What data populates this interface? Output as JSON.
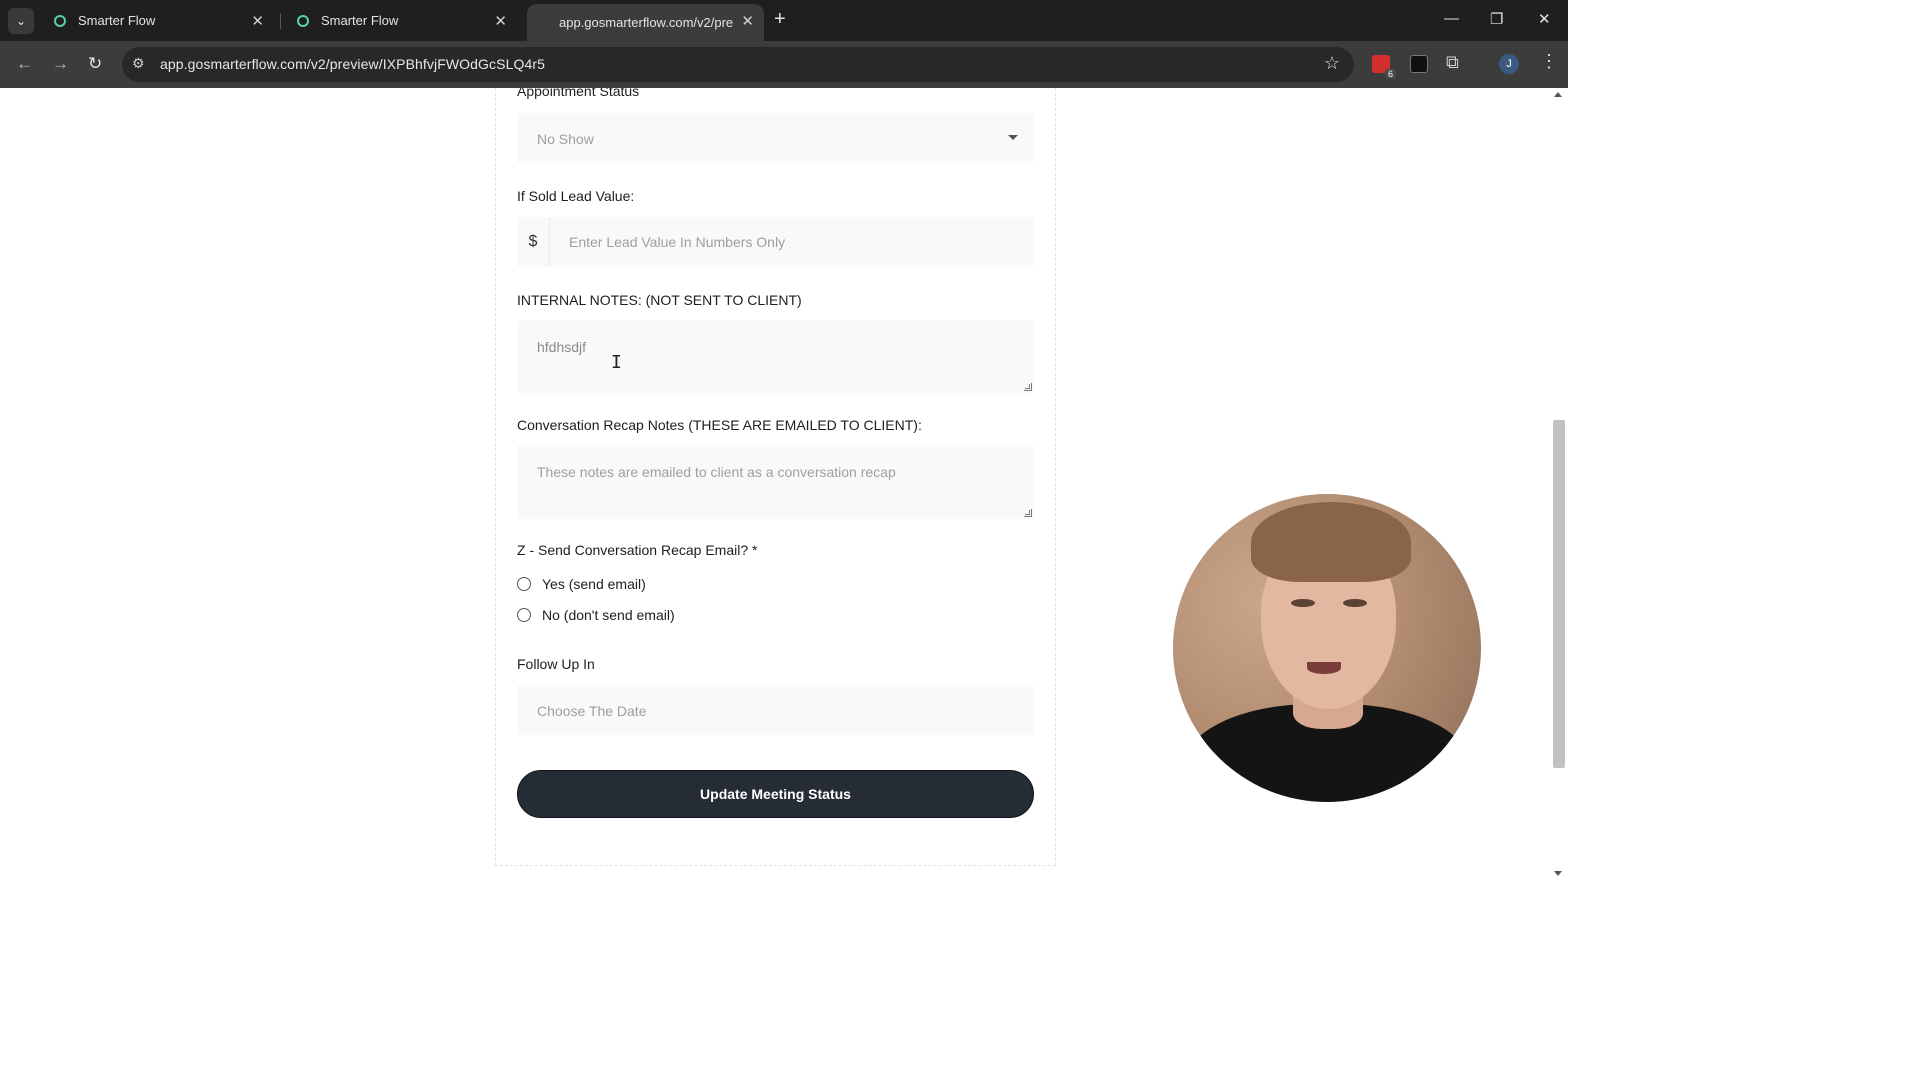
{
  "browser": {
    "tabs": [
      {
        "title": "Smarter Flow"
      },
      {
        "title": "Smarter Flow"
      },
      {
        "title": "app.gosmarterflow.com/v2/pre"
      }
    ],
    "url": "app.gosmarterflow.com/v2/preview/IXPBhfvjFWOdGcSLQ4r5",
    "extension_badge": "6",
    "profile_initial": "J"
  },
  "form": {
    "appointment_status": {
      "label": "Appointment Status",
      "selected": "No Show"
    },
    "lead_value": {
      "label": "If Sold Lead Value:",
      "prefix": "$",
      "placeholder": "Enter Lead Value In Numbers Only"
    },
    "internal_notes": {
      "label": "INTERNAL NOTES: (NOT SENT TO CLIENT)",
      "value": "hfdhsdjf"
    },
    "recap_notes": {
      "label": "Conversation Recap Notes (THESE ARE EMAILED TO CLIENT):",
      "placeholder": "These notes are emailed to client as a conversation recap"
    },
    "send_email": {
      "label": "Z - Send Conversation Recap Email? *",
      "options": [
        "Yes (send email)",
        "No (don't send email)"
      ]
    },
    "follow_up": {
      "label": "Follow Up In",
      "placeholder": "Choose The Date"
    },
    "submit_label": "Update Meeting Status"
  },
  "colors": {
    "button_bg": "#252c35",
    "field_bg": "#f9f9f9",
    "tabbar_bg": "#1f1f1f",
    "toolbar_bg": "#3c3c3c"
  }
}
